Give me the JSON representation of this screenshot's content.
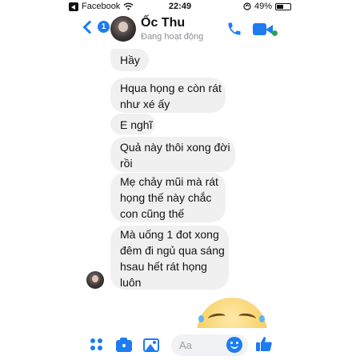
{
  "status_bar": {
    "carrier": "Facebook",
    "time": "22:49",
    "battery_percent": "49%",
    "battery_level": 0.49
  },
  "header": {
    "back_badge": "1",
    "contact_name": "Ốc Thu",
    "contact_status": "Đang hoạt động"
  },
  "messages": [
    {
      "lines": [
        "Hầy"
      ]
    },
    {
      "lines": [
        "Hqua họng e còn rát",
        "như xé ấy"
      ]
    },
    {
      "lines": [
        "E nghĩ"
      ]
    },
    {
      "lines": [
        "Quả này thôi xong đời",
        "rồi"
      ]
    },
    {
      "lines": [
        "Mẹ chảy mũi mà rát",
        "họng thế này chắc",
        "con cũng thế"
      ]
    },
    {
      "lines": [
        "Mà uống 1 đot xong",
        "đêm đi ngủ qua sáng",
        "hsau hết rát họng",
        "luôn"
      ]
    }
  ],
  "composer": {
    "placeholder": "Aa"
  },
  "colors": {
    "accent": "#1e7cf2",
    "bubble": "#f0f0f0",
    "online": "#31a24c"
  },
  "icons": [
    "apps-icon",
    "camera-icon",
    "photo-icon",
    "emoji-icon",
    "like-icon",
    "phone-icon",
    "video-icon",
    "wifi-icon",
    "location-icon"
  ]
}
